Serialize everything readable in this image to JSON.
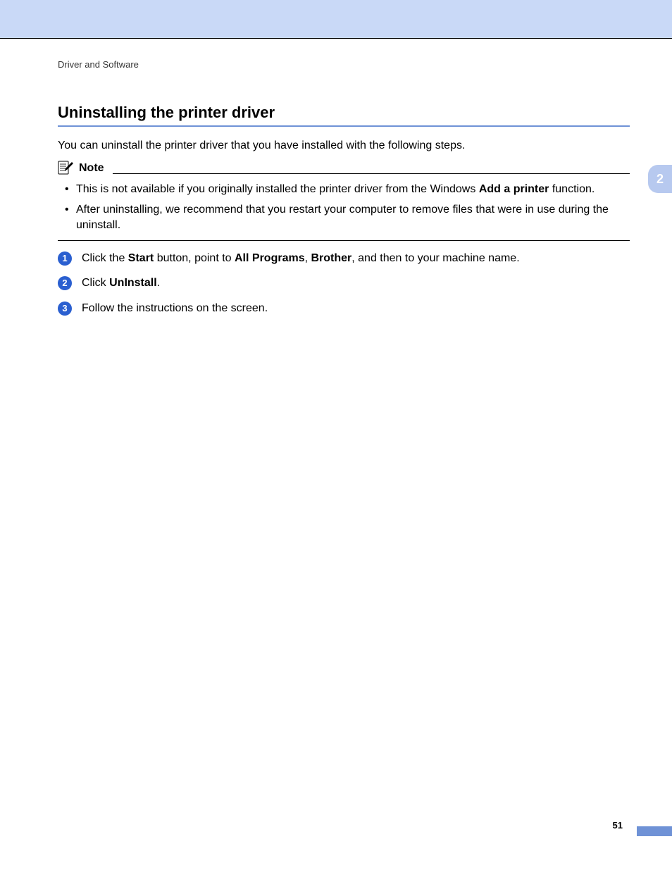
{
  "breadcrumb": "Driver and Software",
  "title": "Uninstalling the printer driver",
  "intro": "You can uninstall the printer driver that you have installed with the following steps.",
  "note": {
    "label": "Note",
    "items": {
      "0": {
        "pre": "This is not available if you originally installed the printer driver from the Windows ",
        "bold": "Add a printer",
        "post": " function."
      },
      "1": {
        "text": "After uninstalling, we recommend that you restart your computer to remove files that were in use during the uninstall."
      }
    }
  },
  "steps": {
    "0": {
      "num": "1",
      "t1": "Click the ",
      "b1": "Start",
      "t2": " button, point to ",
      "b2": "All Programs",
      "t3": ", ",
      "b3": "Brother",
      "t4": ", and then to your machine name."
    },
    "1": {
      "num": "2",
      "t1": "Click ",
      "b1": "UnInstall",
      "t2": "."
    },
    "2": {
      "num": "3",
      "t1": "Follow the instructions on the screen."
    }
  },
  "chapter": "2",
  "page": "51"
}
